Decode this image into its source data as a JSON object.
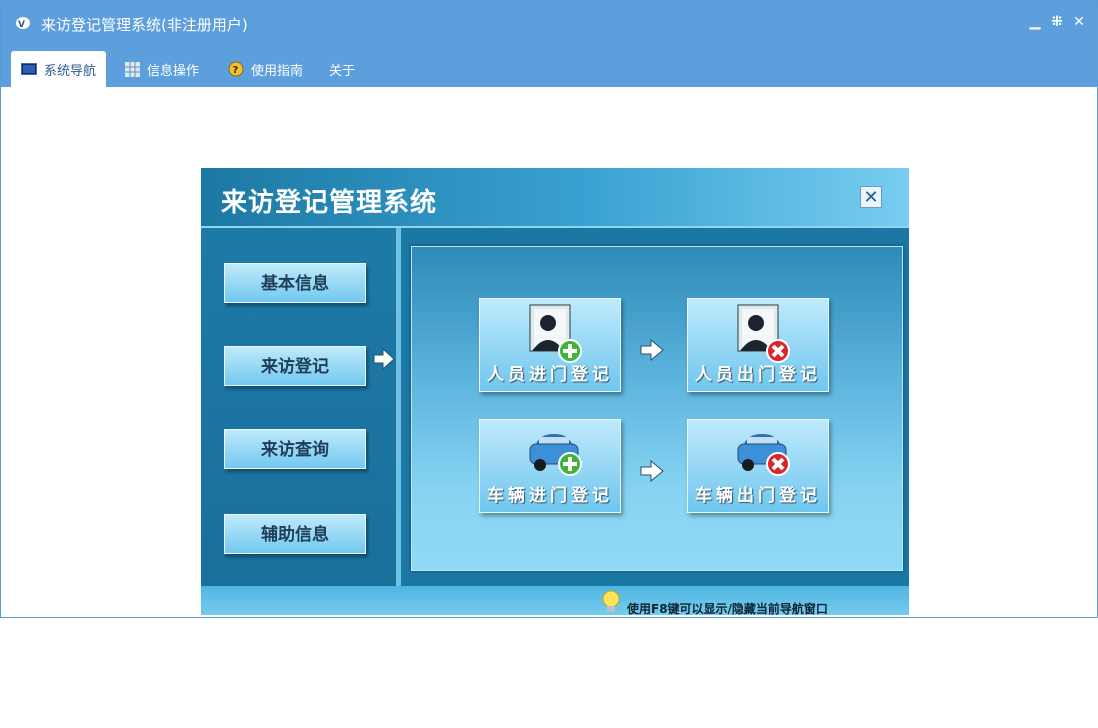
{
  "window": {
    "title": "来访登记管理系统(非注册用户)",
    "controls": [
      "minimize-icon",
      "restore-icon",
      "close-icon"
    ]
  },
  "menu": {
    "items": [
      {
        "label": "系统导航",
        "icon": "monitor-icon",
        "active": true
      },
      {
        "label": "信息操作",
        "icon": "grid-icon",
        "active": false
      },
      {
        "label": "使用指南",
        "icon": "help-icon",
        "active": false
      },
      {
        "label": "关于",
        "icon": "",
        "active": false
      }
    ]
  },
  "panel": {
    "title": "来访登记管理系统",
    "close_icon": "close-icon",
    "nav": [
      {
        "label": "基本信息"
      },
      {
        "label": "来访登记",
        "selected": true
      },
      {
        "label": "来访查询"
      },
      {
        "label": "辅助信息"
      }
    ],
    "tiles": [
      {
        "label": "人员进门登记",
        "icon": "person-add-icon"
      },
      {
        "label": "人员出门登记",
        "icon": "person-remove-icon"
      },
      {
        "label": "车辆进门登记",
        "icon": "car-add-icon"
      },
      {
        "label": "车辆出门登记",
        "icon": "car-remove-icon"
      }
    ],
    "footer_text": "使用F8键可以显示/隐藏当前导航窗口"
  },
  "colors": {
    "titlebar": "#5d9fdd",
    "panel_bg": "#1b77a4",
    "accent_light": "#8fdaf6"
  }
}
